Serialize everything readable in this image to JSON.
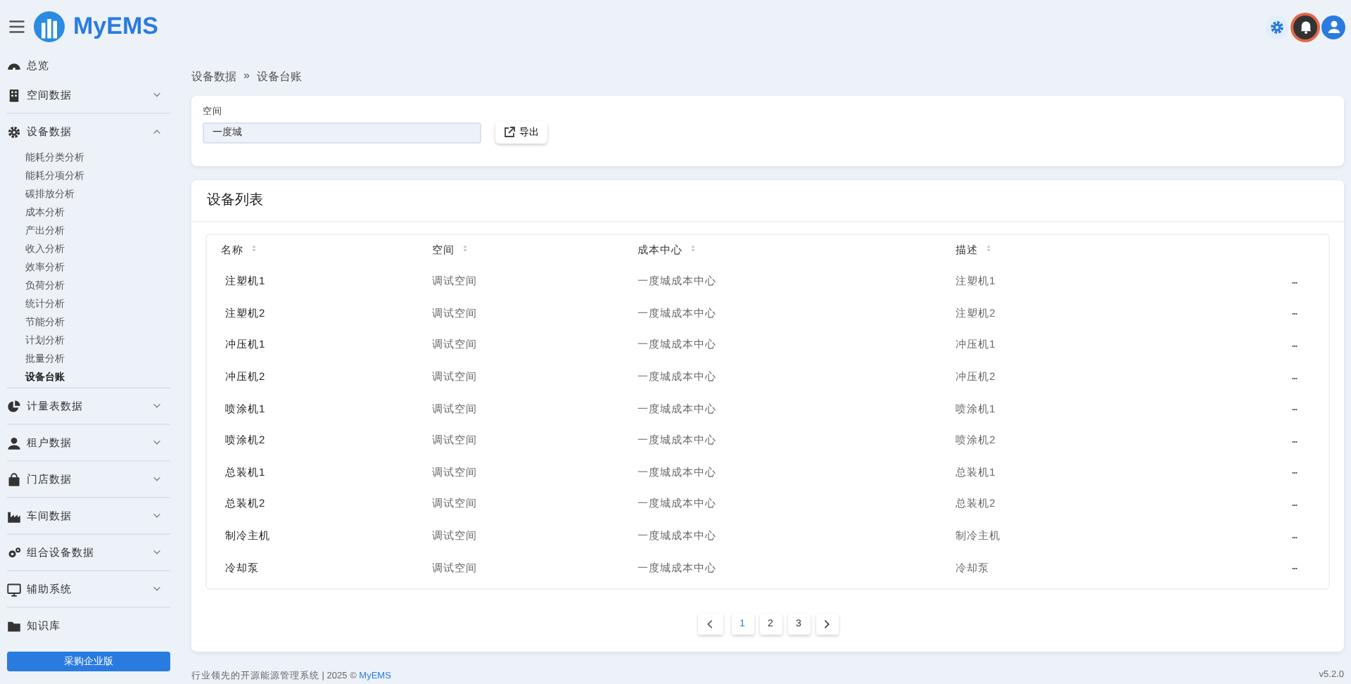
{
  "header": {
    "logo": "MyEMS"
  },
  "sidebar": {
    "items": [
      {
        "label": "总览",
        "kind": "link"
      },
      {
        "label": "空间数据",
        "kind": "group",
        "expanded": false
      },
      {
        "label": "设备数据",
        "kind": "group",
        "expanded": true,
        "children": [
          {
            "label": "能耗分类分析",
            "selected": false
          },
          {
            "label": "能耗分项分析",
            "selected": false
          },
          {
            "label": "碳排放分析",
            "selected": false
          },
          {
            "label": "成本分析",
            "selected": false
          },
          {
            "label": "产出分析",
            "selected": false
          },
          {
            "label": "收入分析",
            "selected": false
          },
          {
            "label": "效率分析",
            "selected": false
          },
          {
            "label": "负荷分析",
            "selected": false
          },
          {
            "label": "统计分析",
            "selected": false
          },
          {
            "label": "节能分析",
            "selected": false
          },
          {
            "label": "计划分析",
            "selected": false
          },
          {
            "label": "批量分析",
            "selected": false
          },
          {
            "label": "设备台账",
            "selected": true
          }
        ]
      },
      {
        "label": "计量表数据",
        "kind": "group",
        "expanded": false
      },
      {
        "label": "租户数据",
        "kind": "group",
        "expanded": false
      },
      {
        "label": "门店数据",
        "kind": "group",
        "expanded": false
      },
      {
        "label": "车间数据",
        "kind": "group",
        "expanded": false
      },
      {
        "label": "组合设备数据",
        "kind": "group",
        "expanded": false
      },
      {
        "label": "辅助系统",
        "kind": "group",
        "expanded": false
      },
      {
        "label": "知识库",
        "kind": "link"
      }
    ],
    "button": "采购企业版"
  },
  "breadcrumb": [
    "设备数据",
    "»",
    "设备台账"
  ],
  "filter": {
    "label": "空间",
    "value": "一度城",
    "button": "导出"
  },
  "table": {
    "title": "设备列表",
    "columns": [
      "名称",
      "空间",
      "成本中心",
      "描述"
    ],
    "rows": [
      [
        "注塑机1",
        "调试空间",
        "一度城成本中心",
        "注塑机1"
      ],
      [
        "注塑机2",
        "调试空间",
        "一度城成本中心",
        "注塑机2"
      ],
      [
        "冲压机1",
        "调试空间",
        "一度城成本中心",
        "冲压机1"
      ],
      [
        "冲压机2",
        "调试空间",
        "一度城成本中心",
        "冲压机2"
      ],
      [
        "喷涂机1",
        "调试空间",
        "一度城成本中心",
        "喷涂机1"
      ],
      [
        "喷涂机2",
        "调试空间",
        "一度城成本中心",
        "喷涂机2"
      ],
      [
        "总装机1",
        "调试空间",
        "一度城成本中心",
        "总装机1"
      ],
      [
        "总装机2",
        "调试空间",
        "一度城成本中心",
        "总装机2"
      ],
      [
        "制冷主机",
        "调试空间",
        "一度城成本中心",
        "制冷主机"
      ],
      [
        "冷却泵",
        "调试空间",
        "一度城成本中心",
        "冷却泵"
      ]
    ],
    "pages": [
      {
        "label": "1",
        "selected": true
      },
      {
        "label": "2",
        "selected": false
      },
      {
        "label": "3",
        "selected": false
      }
    ]
  },
  "footer": {
    "text": "行业领先的开源能源管理系统 | 2025 © ",
    "link": "MyEMS",
    "version": "v5.2.0"
  }
}
